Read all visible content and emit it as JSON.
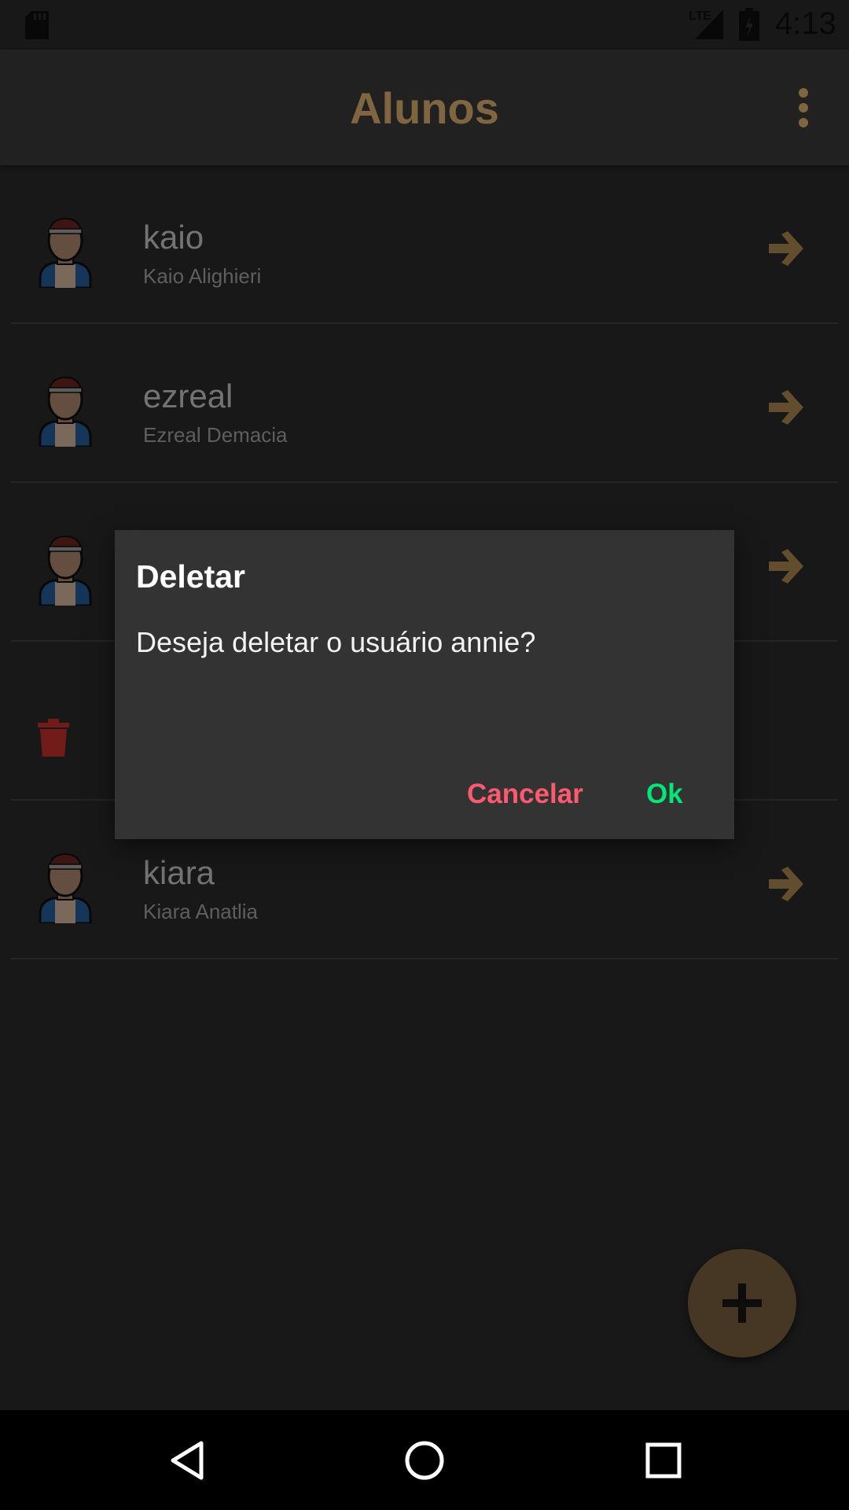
{
  "status_bar": {
    "time": "4:13",
    "network": "LTE",
    "icons": [
      "sd-card-icon",
      "signal-icon",
      "battery-charging-icon"
    ]
  },
  "app_bar": {
    "title": "Alunos",
    "menu_icon": "more-vert-icon"
  },
  "students": [
    {
      "username": "kaio",
      "full_name": "Kaio Alighieri"
    },
    {
      "username": "ezreal",
      "full_name": "Ezreal Demacia"
    },
    {
      "username": "",
      "full_name": ""
    },
    {
      "username": "",
      "full_name": ""
    },
    {
      "username": "kiara",
      "full_name": "Kiara Anatlia"
    }
  ],
  "dialog": {
    "title": "Deletar",
    "message": "Deseja deletar o usuário annie?",
    "cancel_label": "Cancelar",
    "ok_label": "Ok"
  },
  "fab": {
    "icon": "add-icon"
  },
  "nav_bar": {
    "icons": [
      "back-icon",
      "home-icon",
      "recents-icon"
    ]
  },
  "colors": {
    "accent": "#ffcc80",
    "arrow": "#c49a5e",
    "fab": "#8a6e48",
    "cancel": "#ff5a6e",
    "ok": "#00e676",
    "trash": "#c62828"
  }
}
